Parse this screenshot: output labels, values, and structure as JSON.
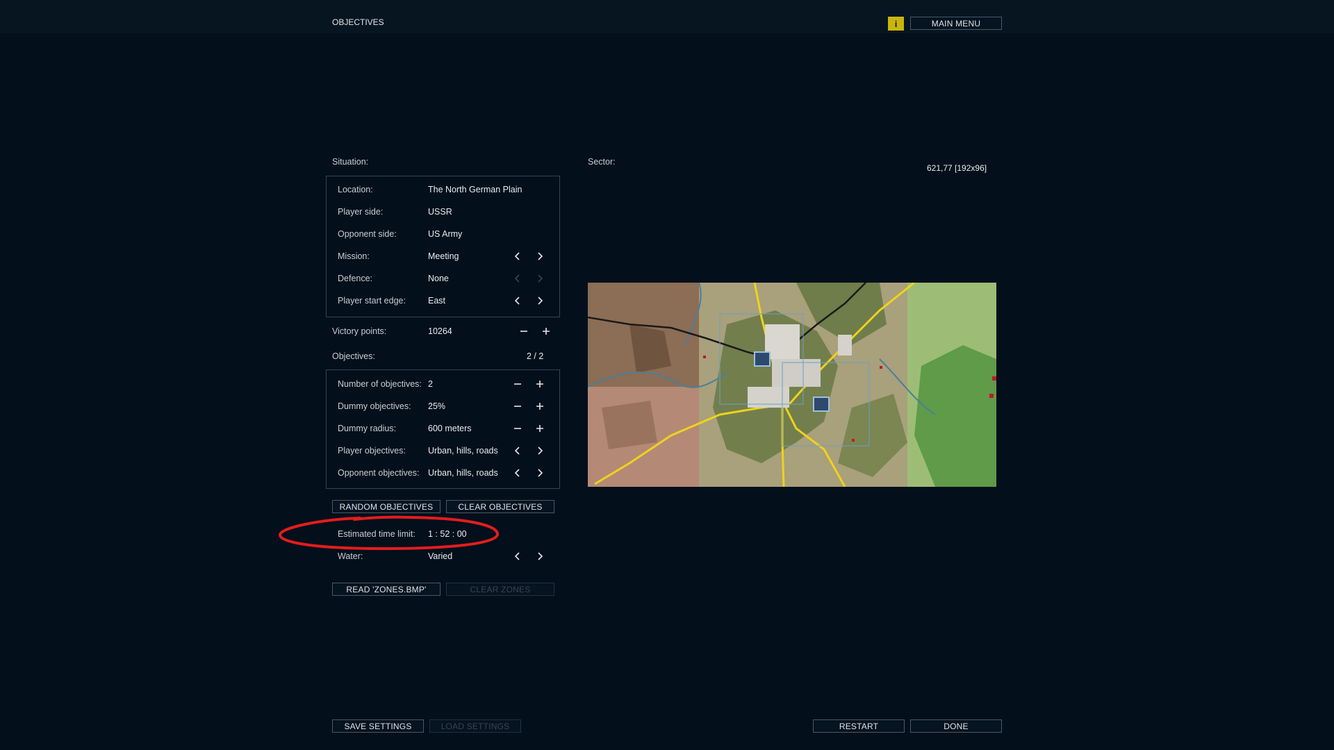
{
  "header": {
    "title": "OBJECTIVES",
    "info_label": "i",
    "main_menu_label": "MAIN MENU"
  },
  "situation": {
    "heading": "Situation:",
    "rows": [
      {
        "label": "Location:",
        "value": "The North German Plain"
      },
      {
        "label": "Player side:",
        "value": "USSR"
      },
      {
        "label": "Opponent side:",
        "value": "US Army"
      },
      {
        "label": "Mission:",
        "value": "Meeting"
      },
      {
        "label": "Defence:",
        "value": "None"
      },
      {
        "label": "Player start edge:",
        "value": "East"
      }
    ]
  },
  "victory": {
    "label": "Victory points:",
    "value": "10264"
  },
  "objectives": {
    "heading": "Objectives:",
    "count": "2 / 2",
    "rows": [
      {
        "label": "Number of objectives:",
        "value": "2"
      },
      {
        "label": "Dummy objectives:",
        "value": "25%"
      },
      {
        "label": "Dummy radius:",
        "value": "600 meters"
      },
      {
        "label": "Player objectives:",
        "value": "Urban, hills, roads"
      },
      {
        "label": "Opponent objectives:",
        "value": "Urban, hills, roads"
      }
    ],
    "random_label": "RANDOM OBJECTIVES",
    "clear_label": "CLEAR OBJECTIVES"
  },
  "time_limit": {
    "label": "Estimated time limit:",
    "value": "1 : 52 : 00"
  },
  "water": {
    "label": "Water:",
    "value": "Varied"
  },
  "zones": {
    "read_label": "READ 'ZONES.BMP'",
    "clear_label": "CLEAR ZONES"
  },
  "sector": {
    "heading": "Sector:",
    "coords": "621,77 [192x96]"
  },
  "footer": {
    "save_label": "SAVE SETTINGS",
    "load_label": "LOAD SETTINGS",
    "restart_label": "RESTART",
    "done_label": "DONE"
  },
  "colors": {
    "background": "#030f1b",
    "accent_yellow": "#c9b50b",
    "annotation_red": "#e21d1d",
    "road": "#f0d21c",
    "river": "#4b7f97",
    "objective_box": "#6aa0c8"
  }
}
